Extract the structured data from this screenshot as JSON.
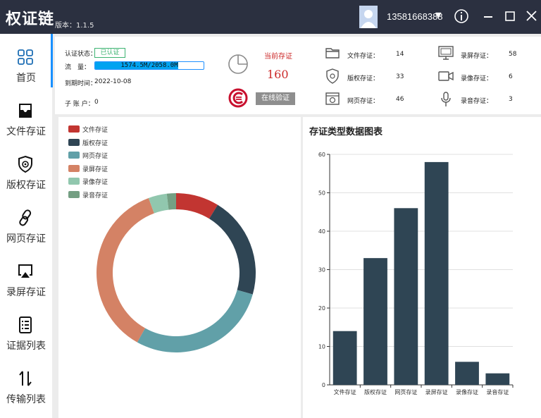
{
  "app": {
    "title": "权证链",
    "version": "版本：1.1.5",
    "phone": "13581668388"
  },
  "sidebar": {
    "items": [
      {
        "label": "首页",
        "icon": "grid-icon"
      },
      {
        "label": "文件存证",
        "icon": "inbox-icon"
      },
      {
        "label": "版权存证",
        "icon": "shield-icon"
      },
      {
        "label": "网页存证",
        "icon": "link-icon"
      },
      {
        "label": "录屏存证",
        "icon": "airplay-icon"
      },
      {
        "label": "证据列表",
        "icon": "list-icon"
      },
      {
        "label": "传输列表",
        "icon": "transfer-icon"
      }
    ]
  },
  "info": {
    "auth_label": "认证状态：",
    "auth_value": "已认证",
    "flow_label": "流　量：",
    "flow_text": "1574.5M/2058.0M",
    "flow_progress": 0.765,
    "expire_label": "到期时间：",
    "expire_value": "2022-10-08",
    "sub_label": "子 账 户：",
    "sub_value": "0",
    "current_label": "当前存证",
    "current_value": "160",
    "verify_button": "在线验证"
  },
  "stats": [
    {
      "label": "文件存证：",
      "value": "14",
      "icon": "folder-icon"
    },
    {
      "label": "版权存证：",
      "value": "33",
      "icon": "copyright-shield-icon"
    },
    {
      "label": "网页存证：",
      "value": "46",
      "icon": "webpage-icon"
    },
    {
      "label": "录屏存证：",
      "value": "58",
      "icon": "monitor-icon"
    },
    {
      "label": "录像存证：",
      "value": "6",
      "icon": "video-icon"
    },
    {
      "label": "录音存证：",
      "value": "3",
      "icon": "microphone-icon"
    }
  ],
  "colors": {
    "topbar": "#2b3040",
    "accent": "#1890ff",
    "red": "#c23531",
    "navy": "#2f4554",
    "teal": "#61a0a8",
    "orange": "#d48265",
    "mint": "#91c7ae",
    "green": "#749f83"
  },
  "chart_data": [
    {
      "type": "pie",
      "donut": true,
      "legend": "top-left",
      "categories": [
        "文件存证",
        "版权存证",
        "网页存证",
        "录屏存证",
        "录像存证",
        "录音存证"
      ],
      "values": [
        14,
        33,
        46,
        58,
        6,
        3
      ],
      "colors": [
        "#c23531",
        "#2f4554",
        "#61a0a8",
        "#d48265",
        "#91c7ae",
        "#749f83"
      ]
    },
    {
      "type": "bar",
      "title": "存证类型数据图表",
      "categories": [
        "文件存证",
        "版权存证",
        "网页存证",
        "录屏存证",
        "录像存证",
        "录音存证"
      ],
      "values": [
        14,
        33,
        46,
        58,
        6,
        3
      ],
      "ylim": [
        0,
        60
      ],
      "yticks": [
        0,
        10,
        20,
        30,
        40,
        50,
        60
      ],
      "grid": true,
      "color": "#2f4554"
    }
  ]
}
